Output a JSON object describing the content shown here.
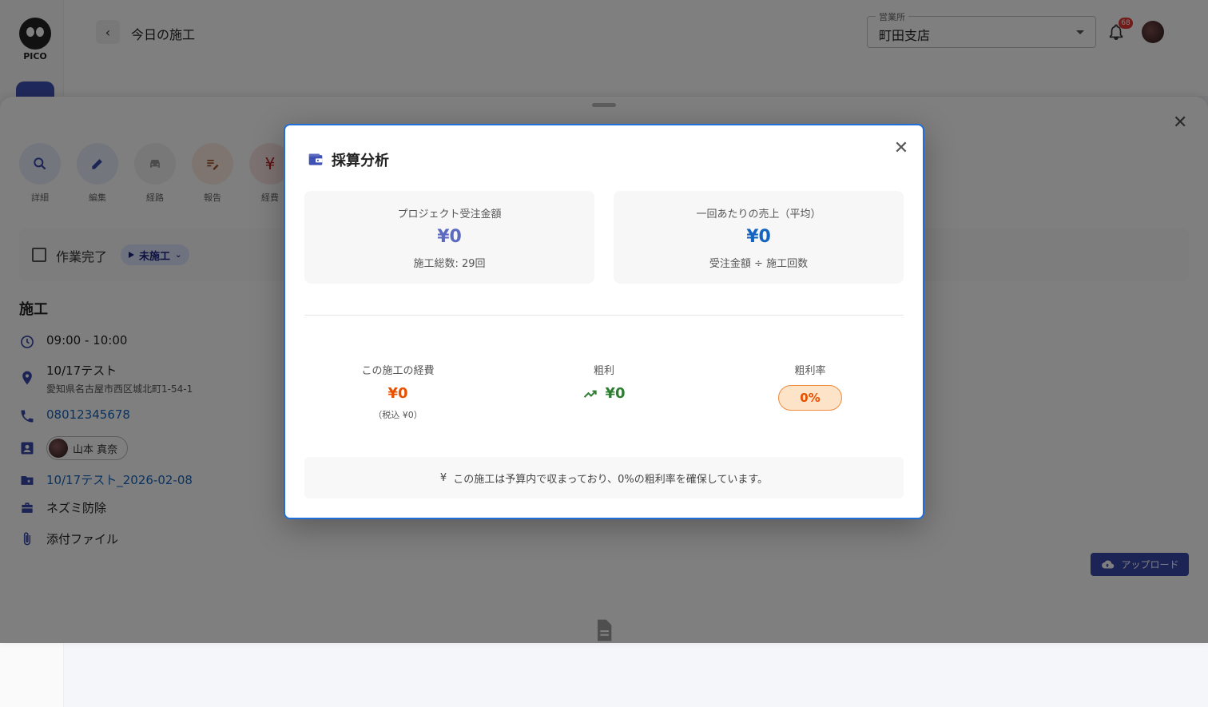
{
  "app": {
    "logo_text": "PICO",
    "page_title": "今日の施工"
  },
  "header": {
    "office_label": "営業所",
    "office_value": "町田支店",
    "notification_count": "68"
  },
  "actions": [
    {
      "label": "詳細",
      "icon": "search-icon"
    },
    {
      "label": "編集",
      "icon": "pencil-icon"
    },
    {
      "label": "経路",
      "icon": "car-icon"
    },
    {
      "label": "報告",
      "icon": "report-icon"
    },
    {
      "label": "経費",
      "icon": "yen-icon"
    }
  ],
  "status": {
    "complete_label": "作業完了",
    "state_label": "未施工"
  },
  "detail": {
    "section_title": "施工",
    "time": "09:00 - 10:00",
    "site_name": "10/17テスト",
    "address": "愛知県名古屋市西区城北町1-54-1",
    "phone": "08012345678",
    "staff": "山本 真奈",
    "project": "10/17テスト_2026-02-08",
    "service": "ネズミ防除",
    "attachments_label": "添付ファイル",
    "upload_label": "アップロード"
  },
  "dialog": {
    "title": "採算分析",
    "order_card": {
      "label": "プロジェクト受注金額",
      "value": "¥0",
      "sub": "施工総数: 29回"
    },
    "avg_card": {
      "label": "一回あたりの売上（平均）",
      "value": "¥0",
      "sub": "受注金額 ÷ 施工回数"
    },
    "expense": {
      "label": "この施工の経費",
      "value": "¥0",
      "sub": "（税込 ¥0）"
    },
    "gross_profit": {
      "label": "粗利",
      "value": "¥0"
    },
    "margin": {
      "label": "粗利率",
      "value": "0%"
    },
    "note_icon": "¥",
    "note": "この施工は予算内で収まっており、0%の粗利率を確保しています。"
  },
  "colors": {
    "primary": "#3949ab",
    "dialog_border": "#1e6fd9",
    "order_value": "#5c6bc0",
    "avg_value": "#1565c0",
    "expense_value": "#e65100",
    "profit_value": "#2e7d32",
    "margin_chip": "#fde3c8"
  }
}
